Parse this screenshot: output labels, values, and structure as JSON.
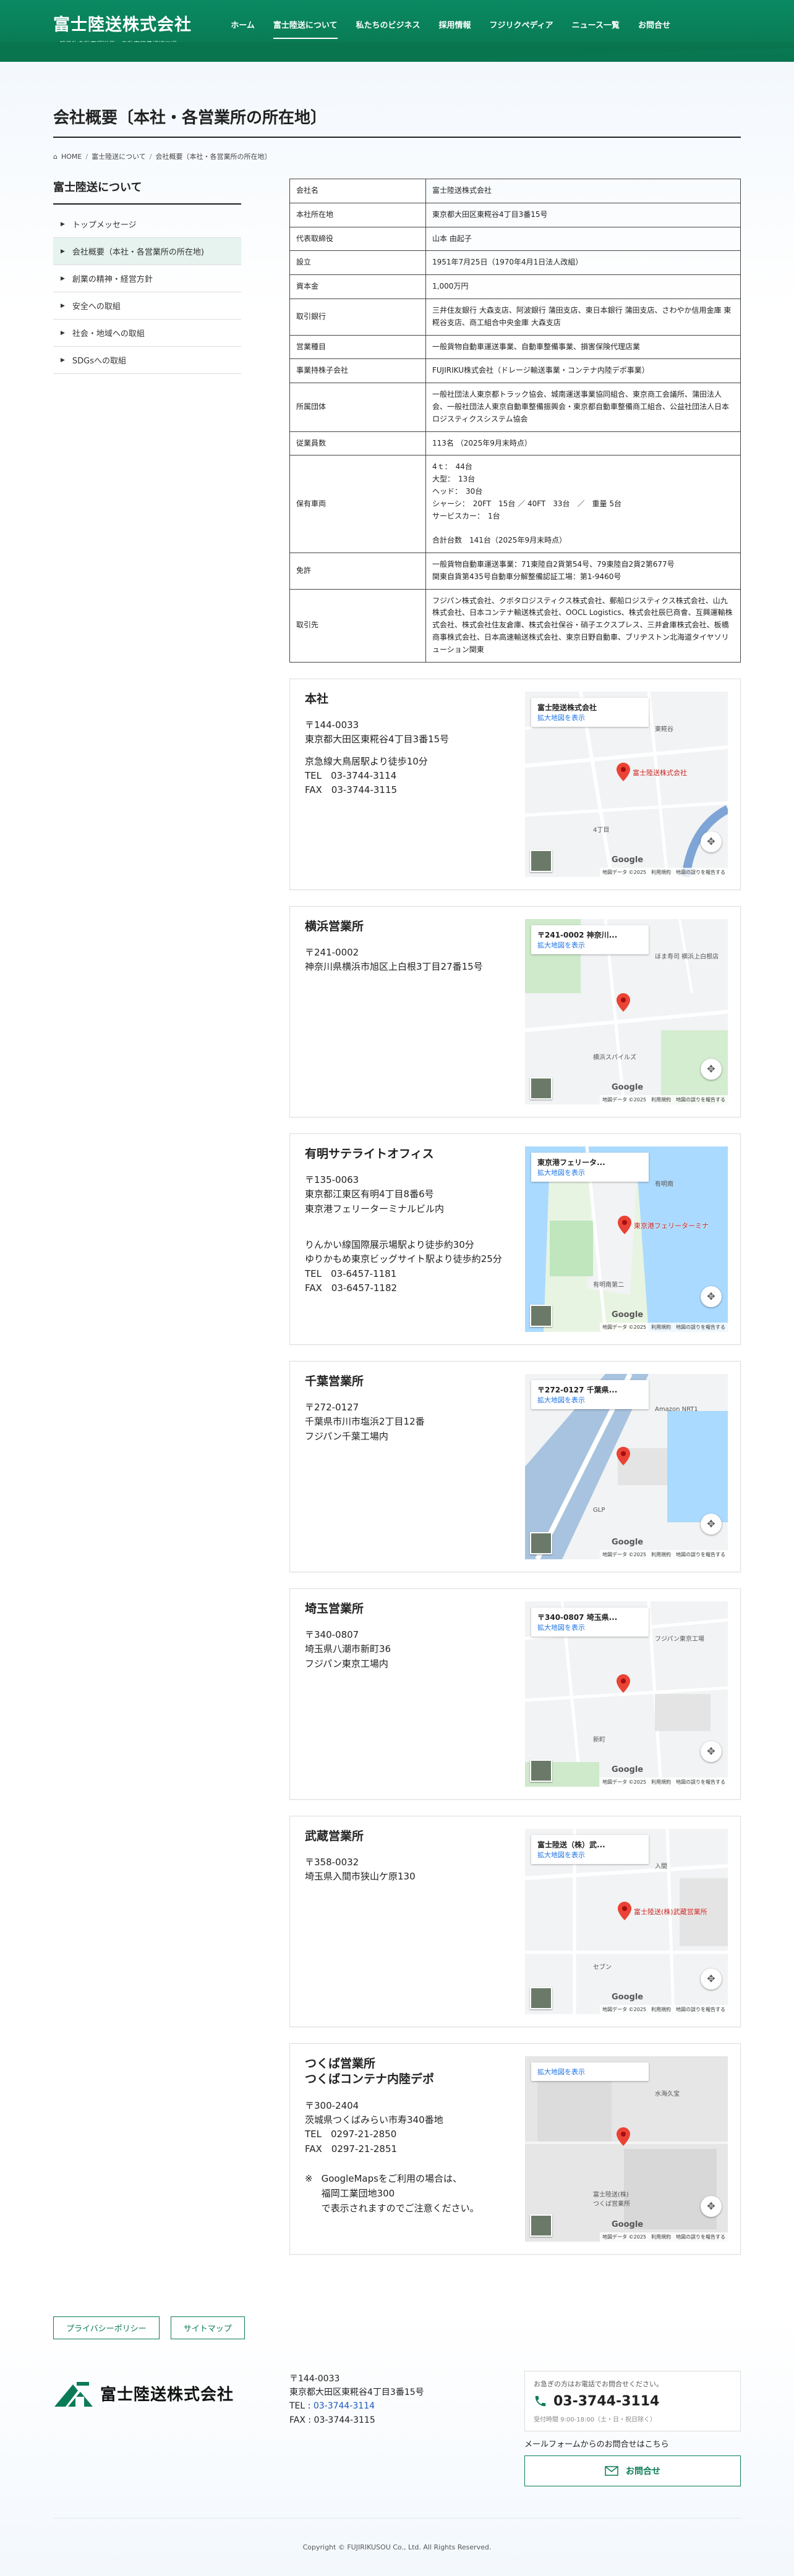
{
  "header": {
    "brand_name": "富士陸送株式会社",
    "brand_sub": "一般貨物自動車運送業　自動車整備認証工場",
    "nav": [
      "ホーム",
      "富士陸送について",
      "私たちのビジネス",
      "採用情報",
      "フジリクペディア",
      "ニュース一覧",
      "お問合せ"
    ]
  },
  "page": {
    "title": "会社概要〔本社・各営業所の所在地〕",
    "breadcrumb": [
      "HOME",
      "富士陸送について",
      "会社概要〔本社・各営業所の所在地〕"
    ]
  },
  "sidebar": {
    "title": "富士陸送について",
    "items": [
      "トップメッセージ",
      "会社概要（本社・各営業所の所在地)",
      "創業の精神・経営方針",
      "安全への取組",
      "社会・地域への取組",
      "SDGsへの取組"
    ]
  },
  "company": [
    {
      "label": "会社名",
      "value": "富士陸送株式会社"
    },
    {
      "label": "本社所在地",
      "value": "東京都大田区東糀谷4丁目3番15号"
    },
    {
      "label": "代表取締役",
      "value": "山本 由起子"
    },
    {
      "label": "設立",
      "value": "1951年7月25日（1970年4月1日法人改組）"
    },
    {
      "label": "資本金",
      "value": "1,000万円"
    },
    {
      "label": "取引銀行",
      "value": "三井住友銀行 大森支店、阿波銀行 蒲田支店、東日本銀行 蒲田支店、さわやか信用金庫 東糀谷支店、商工組合中央金庫 大森支店"
    },
    {
      "label": "営業種目",
      "value": "一般貨物自動車運送事業、自動車整備事業、損害保険代理店業"
    },
    {
      "label": "事業持株子会社",
      "value": "FUJIRIKU株式会社（ドレージ輸送事業・コンテナ内陸デポ事業）"
    },
    {
      "label": "所属団体",
      "value": "一般社団法人東京都トラック協会、城南運送事業協同組合、東京商工会議所、蒲田法人会、一般社団法人東京自動車整備振興会・東京都自動車整備商工組合、公益社団法人日本ロジスティクスシステム協会"
    },
    {
      "label": "従業員数",
      "value": "113名 （2025年9月末時点）"
    },
    {
      "label": "保有車両",
      "value": "4ｔ：　44台\n大型：　13台\nヘッド：　30台\nシャーシ：　20FT　15台 ／ 40FT　33台　／　重量 5台\nサービスカー：　1台\n\n合計台数　141台（2025年9月末時点）"
    },
    {
      "label": "免許",
      "value": "一般貨物自動車運送事業：71東陸自2貨第54号、79東陸自2貨2第677号\n関東自貨第435号自動車分解整備認証工場：第1-9460号"
    },
    {
      "label": "取引先",
      "value": "フジパン株式会社、クボタロジスティクス株式会社、郵船ロジスティクス株式会社、山九株式会社、日本コンテナ輸送株式会社、OOCL Logistics、株式会社辰巳商會、互興運輸株式会社、株式会社住友倉庫、株式会社保谷・硝子エクスプレス、三井倉庫株式会社、板橋商事株式会社、日本高速輸送株式会社、東京日野自動車、ブリヂストン北海道タイヤソリューション関東"
    }
  ],
  "offices": [
    {
      "name": "本社",
      "lines": "〒144-0033\n東京都大田区東糀谷4丁目3番15号",
      "extra": "京急線大鳥居駅より徒歩10分\nTEL　03-3744-3114\nFAX　03-3744-3115",
      "map": {
        "card_title": "富士陸送株式会社",
        "card_link": "拡大地図を表示",
        "pin_label": "富士陸送株式会社",
        "place_a": "東糀谷",
        "place_b": "4丁目"
      }
    },
    {
      "name": "横浜営業所",
      "lines": "〒241-0002\n神奈川県横浜市旭区上白根3丁目27番15号",
      "extra": "",
      "map": {
        "card_title": "〒241-0002 神奈川...",
        "card_link": "拡大地図を表示",
        "pin_label": "",
        "place_a": "ほま寿司 横浜上白根店",
        "place_b": "横浜スパイルズ"
      }
    },
    {
      "name": "有明サテライトオフィス",
      "lines": "〒135-0063\n東京都江東区有明4丁目8番6号\n東京港フェリーターミナルビル内",
      "extra": "\nりんかい線国際展示場駅より徒歩約30分\nゆりかもめ東京ビッグサイト駅より徒歩約25分\nTEL　03-6457-1181\nFAX　03-6457-1182",
      "map": {
        "card_title": "東京港フェリータ...",
        "card_link": "拡大地図を表示",
        "pin_label": "東京港フェリーターミナ",
        "place_a": "有明南",
        "place_b": "有明南第二"
      }
    },
    {
      "name": "千葉営業所",
      "lines": "〒272-0127\n千葉県市川市塩浜2丁目12番\nフジパン千葉工場内",
      "extra": "",
      "map": {
        "card_title": "〒272-0127 千葉県...",
        "card_link": "拡大地図を表示",
        "pin_label": "",
        "place_a": "Amazon NRT1",
        "place_b": "GLP"
      }
    },
    {
      "name": "埼玉営業所",
      "lines": "〒340-0807\n埼玉県八潮市新町36\nフジパン東京工場内",
      "extra": "",
      "map": {
        "card_title": "〒340-0807 埼玉県...",
        "card_link": "拡大地図を表示",
        "pin_label": "",
        "place_a": "フジパン東京工場",
        "place_b": "新町"
      }
    },
    {
      "name": "武蔵営業所",
      "lines": "〒358-0032\n埼玉県入間市狭山ケ原130",
      "extra": "",
      "map": {
        "card_title": "富士陸送（株）武...",
        "card_link": "拡大地図を表示",
        "pin_label": "富士陸送(株)武蔵営業所",
        "place_a": "入間",
        "place_b": "セブン"
      }
    },
    {
      "name": "つくば営業所\nつくばコンテナ内陸デポ",
      "lines": "〒300-2404\n茨城県つくばみらい市寿340番地\nTEL　0297-21-2850\nFAX　0297-21-2851",
      "extra": "",
      "note_mark": "※",
      "note": "GoogleMapsをご利用の場合は、\n福岡工業団地300\nで表示されますのでご注意ください。",
      "map": {
        "card_title": "",
        "card_link": "拡大地図を表示",
        "pin_label": "",
        "place_a": "水海久宝",
        "place_b": "富士陸送(株)\nつくば営業所"
      }
    }
  ],
  "map_common": {
    "google": "Google",
    "attribution": "地図データ ©2025　利用規約　地図の誤りを報告する"
  },
  "footer": {
    "buttons": [
      "プライバシーポリシー",
      "サイトマップ"
    ],
    "logo_text": "富士陸送株式会社",
    "address_1": "〒144-0033",
    "address_2": "東京都大田区東糀谷4丁目3番15号",
    "tel_label": "TEL :",
    "tel": "03-3744-3114",
    "fax": "FAX : 03-3744-3115",
    "contact_small": "お急ぎの方はお電話でお問合せください。",
    "contact_tel": "03-3744-3114",
    "contact_hours": "受付時間 9:00-18:00（土・日・祝日除く）",
    "mail_label": "メールフォームからのお問合せはこちら",
    "mail_button": "お問合せ",
    "copyright": "Copyright © FUJIRIKUSOU Co., Ltd. All Rights Reserved."
  },
  "colors": {
    "brand": "#0a7b56",
    "link": "#1a73e8",
    "pin": "#ea4335"
  }
}
